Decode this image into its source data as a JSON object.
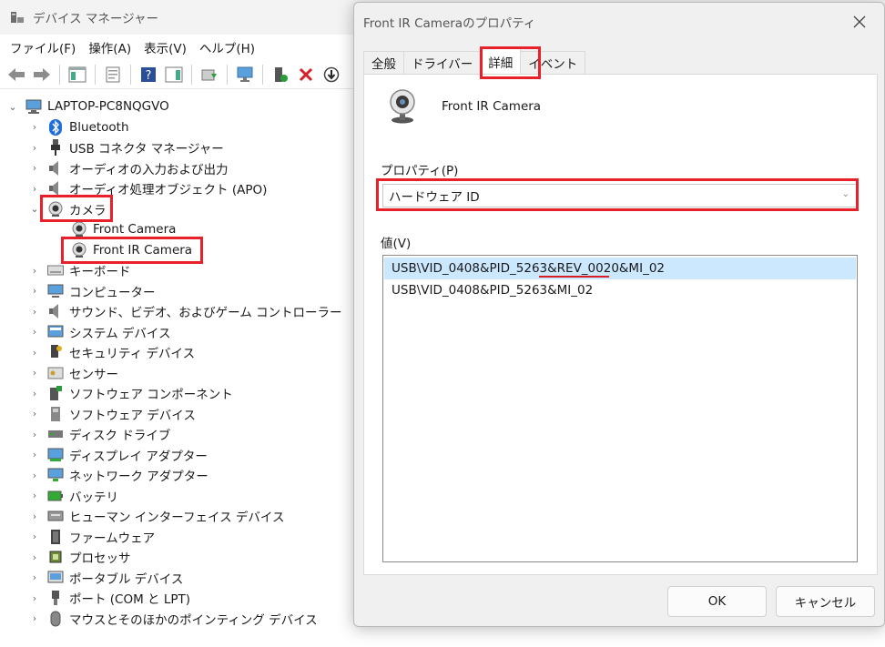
{
  "dm": {
    "title": "デバイス マネージャー",
    "menu": [
      "ファイル(F)",
      "操作(A)",
      "表示(V)",
      "ヘルプ(H)"
    ],
    "toolbar_icons": [
      "back-arrow-icon",
      "forward-arrow-icon",
      "show-hide-tree-icon",
      "properties-icon",
      "help-icon",
      "action-pane-icon",
      "update-driver-icon",
      "scan-hardware-icon",
      "enable-device-icon",
      "uninstall-device-icon",
      "disable-device-icon"
    ],
    "tree": {
      "root": "LAPTOP-PC8NQGVO",
      "items": [
        {
          "label": "Bluetooth",
          "icon": "bluetooth-icon"
        },
        {
          "label": "USB コネクタ マネージャー",
          "icon": "usb-connector-icon"
        },
        {
          "label": "オーディオの入力および出力",
          "icon": "speaker-icon"
        },
        {
          "label": "オーディオ処理オブジェクト (APO)",
          "icon": "speaker-icon"
        },
        {
          "label": "カメラ",
          "icon": "camera-icon",
          "expanded": true,
          "children": [
            "Front Camera",
            "Front IR Camera"
          ]
        },
        {
          "label": "キーボード",
          "icon": "keyboard-icon"
        },
        {
          "label": "コンピューター",
          "icon": "computer-icon"
        },
        {
          "label": "サウンド、ビデオ、およびゲーム コントローラー",
          "icon": "speaker-icon"
        },
        {
          "label": "システム デバイス",
          "icon": "system-device-icon"
        },
        {
          "label": "セキュリティ デバイス",
          "icon": "security-device-icon"
        },
        {
          "label": "センサー",
          "icon": "sensor-icon"
        },
        {
          "label": "ソフトウェア コンポーネント",
          "icon": "software-component-icon"
        },
        {
          "label": "ソフトウェア デバイス",
          "icon": "software-device-icon"
        },
        {
          "label": "ディスク ドライブ",
          "icon": "disk-drive-icon"
        },
        {
          "label": "ディスプレイ アダプター",
          "icon": "display-adapter-icon"
        },
        {
          "label": "ネットワーク アダプター",
          "icon": "network-adapter-icon"
        },
        {
          "label": "バッテリ",
          "icon": "battery-icon"
        },
        {
          "label": "ヒューマン インターフェイス デバイス",
          "icon": "hid-icon"
        },
        {
          "label": "ファームウェア",
          "icon": "firmware-icon"
        },
        {
          "label": "プロセッサ",
          "icon": "processor-icon"
        },
        {
          "label": "ポータブル デバイス",
          "icon": "portable-device-icon"
        },
        {
          "label": "ポート (COM と LPT)",
          "icon": "port-icon"
        },
        {
          "label": "マウスとそのほかのポインティング デバイス",
          "icon": "mouse-icon"
        }
      ]
    }
  },
  "dialog": {
    "title": "Front IR Cameraのプロパティ",
    "tabs": [
      "全般",
      "ドライバー",
      "詳細",
      "イベント"
    ],
    "active_tab": "詳細",
    "device_name": "Front IR Camera",
    "property_label": "プロパティ(P)",
    "property_value": "ハードウェア ID",
    "value_label": "値(V)",
    "values": [
      "USB\\VID_0408&PID_5263&REV_0020&MI_02",
      "USB\\VID_0408&PID_5263&MI_02"
    ],
    "ok": "OK",
    "cancel": "キャンセル"
  },
  "colors": {
    "highlight": "#e8202a",
    "selection": "#cce8ff",
    "underline": "#d81f26"
  }
}
